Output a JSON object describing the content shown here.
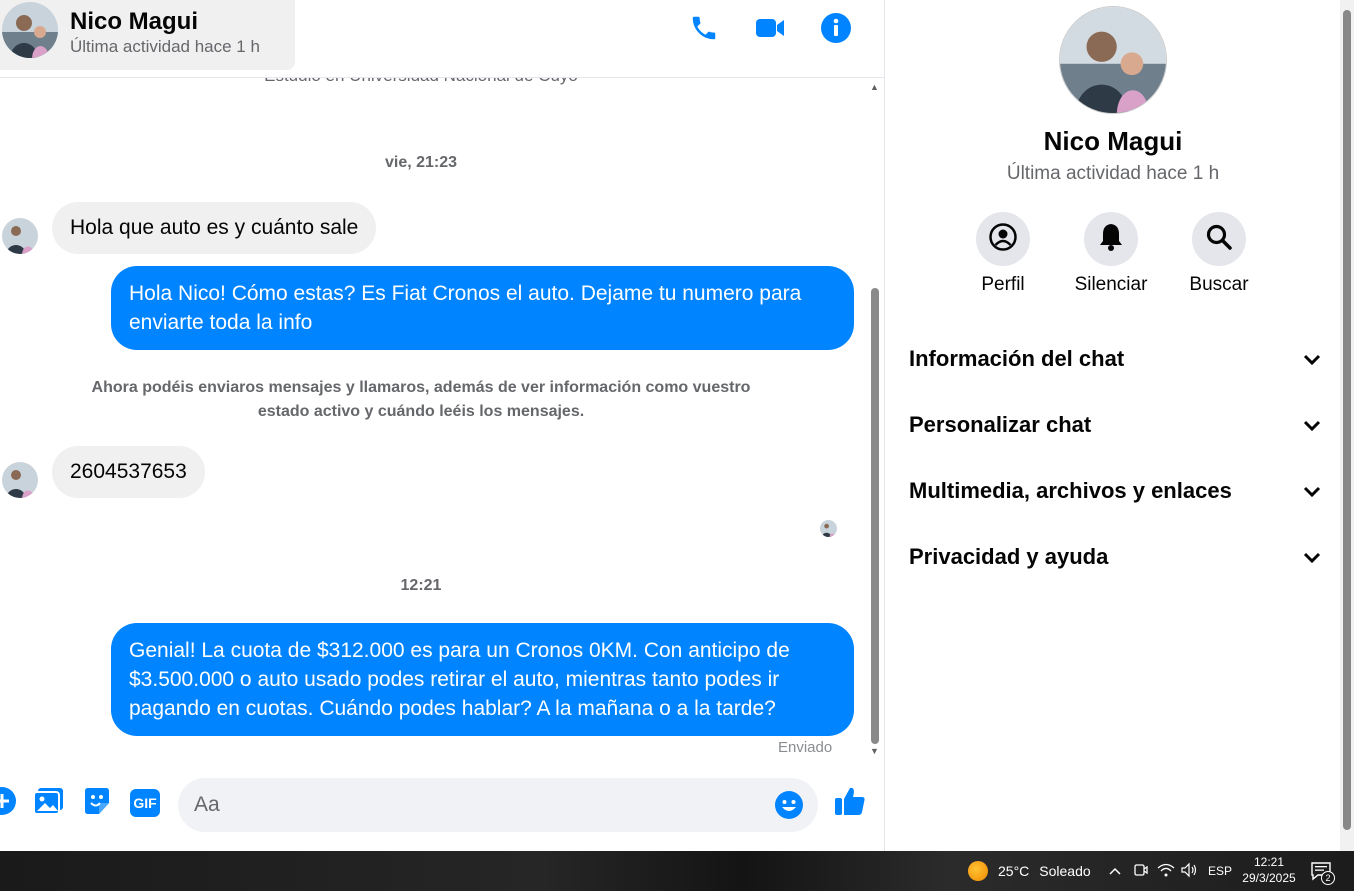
{
  "contact": {
    "name": "Nico Magui",
    "status": "Última actividad hace 1 h"
  },
  "header": {
    "icons": [
      "phone-icon",
      "video-camera-icon",
      "info-icon"
    ]
  },
  "conversation": {
    "cut_off_text": "Estudió en Universidad Nacional de Cuyo",
    "date_separator_1": "vie, 21:23",
    "msg1": "Hola que auto es y cuánto sale",
    "msg2": "Hola Nico! Cómo estas? Es Fiat Cronos el auto. Dejame tu numero para enviarte toda la info",
    "system_note": "Ahora podéis enviaros mensajes y llamaros, además de ver información como vuestro estado activo y cuándo leéis los mensajes.",
    "msg3": "2604537653",
    "date_separator_2": "12:21",
    "msg4": "Genial! La cuota de $312.000 es para un Cronos 0KM. Con anticipo de $3.500.000 o auto usado podes retirar el auto, mientras tanto podes ir pagando en cuotas. Cuándo podes hablar? A la mañana o a la tarde?",
    "sent_status": "Enviado"
  },
  "composer": {
    "placeholder": "Aa",
    "icons": [
      "plus-icon",
      "photo-icon",
      "sticker-icon",
      "gif-icon",
      "emoji-icon",
      "thumbs-up-icon"
    ],
    "gif_label": "GIF"
  },
  "panel": {
    "actions": [
      {
        "label": "Perfil",
        "icon": "profile-icon"
      },
      {
        "label": "Silenciar",
        "icon": "bell-icon"
      },
      {
        "label": "Buscar",
        "icon": "search-icon"
      }
    ],
    "sections": [
      {
        "label": "Información del chat"
      },
      {
        "label": "Personalizar chat"
      },
      {
        "label": "Multimedia, archivos y enlaces"
      },
      {
        "label": "Privacidad y ayuda"
      }
    ]
  },
  "taskbar": {
    "weather_temp": "25°C",
    "weather_text": "Soleado",
    "language": "ESP",
    "time": "12:21",
    "date": "29/3/2025",
    "notifications_count": "2"
  },
  "colors": {
    "accent": "#0084ff",
    "incoming_bubble": "#f0f0f0",
    "muted_text": "#65676b"
  }
}
